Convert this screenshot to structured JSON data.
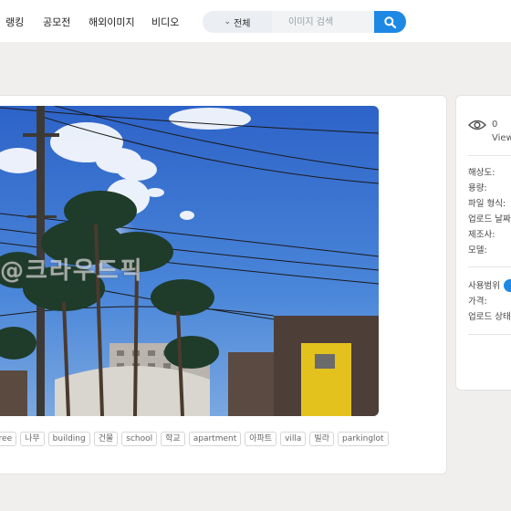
{
  "nav": {
    "items": [
      "랭킹",
      "공모전",
      "해외이미지",
      "비디오"
    ]
  },
  "search": {
    "category": "전체",
    "placeholder": "이미지 검색"
  },
  "photo": {
    "watermark": "@크라우드픽"
  },
  "tags": [
    "tree",
    "나무",
    "building",
    "건물",
    "school",
    "학교",
    "apartment",
    "아파트",
    "villa",
    "빌라",
    "parkinglot"
  ],
  "sidebar": {
    "view_count": "0",
    "view_label": "Views",
    "specs": [
      "해상도:",
      "용량:",
      "파일 형식:",
      "업로드 날짜",
      "제조사:",
      "모델:"
    ],
    "usage": [
      "사용범위",
      "가격:",
      "업로드 상태"
    ]
  },
  "colors": {
    "accent": "#1e88e5",
    "background": "#f0efee"
  }
}
